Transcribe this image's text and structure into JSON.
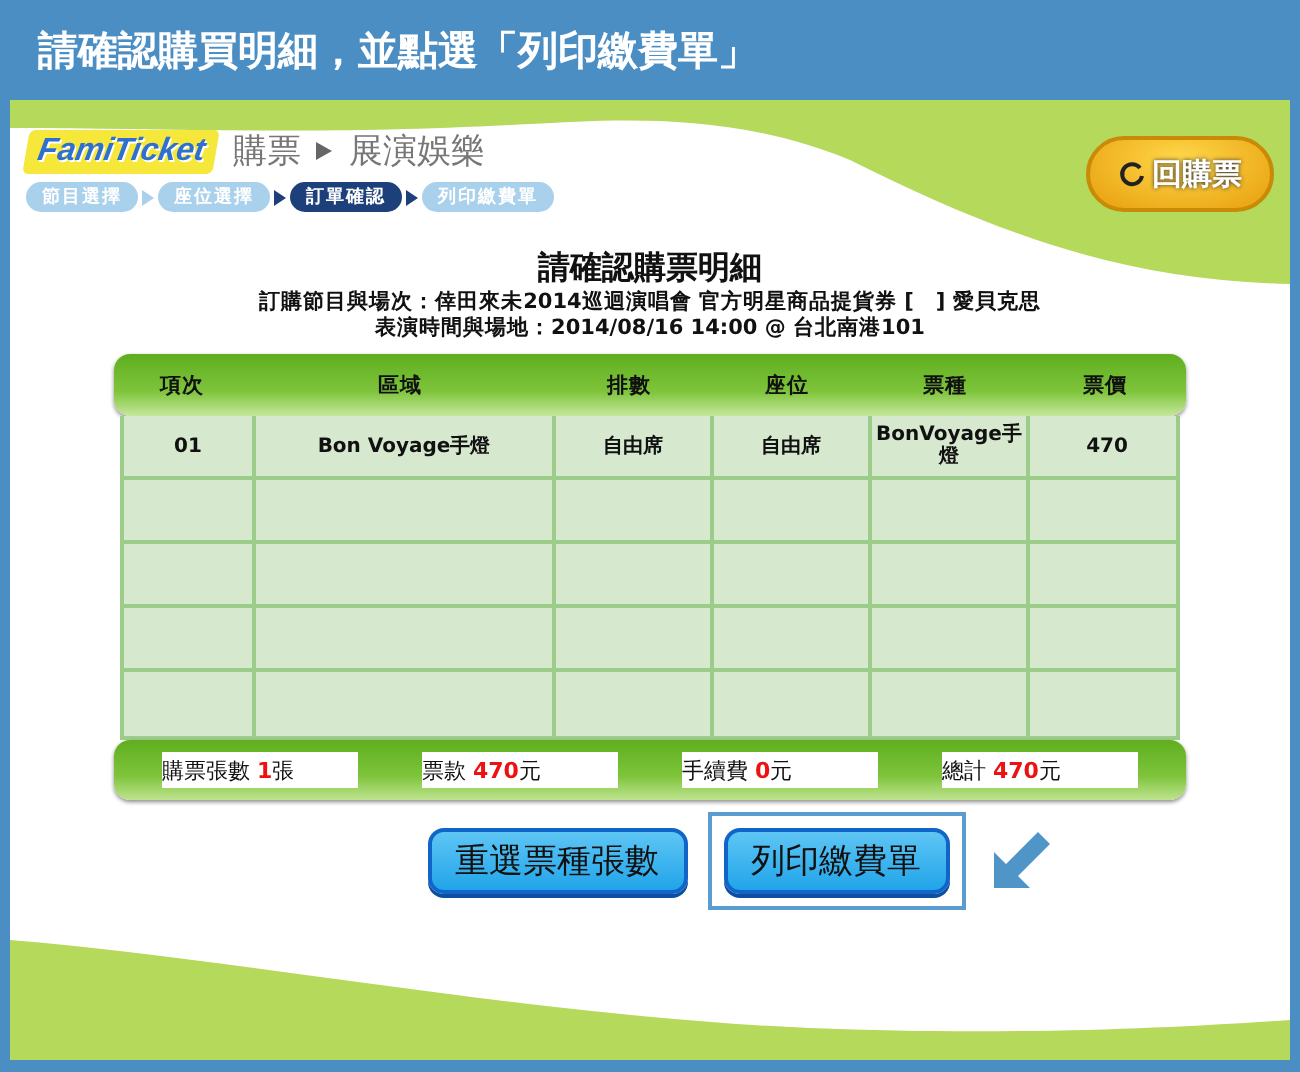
{
  "header": {
    "title": "請確認購買明細，並點選「列印繳費單」"
  },
  "logo": {
    "text": "FamiTicket"
  },
  "breadcrumb": [
    "購票",
    "展演娛樂"
  ],
  "return_button": {
    "label": "回購票"
  },
  "steps": [
    {
      "label": "節目選擇",
      "selected": false
    },
    {
      "label": "座位選擇",
      "selected": false
    },
    {
      "label": "訂單確認",
      "selected": true
    },
    {
      "label": "列印繳費單",
      "selected": false
    }
  ],
  "page_title": "請確認購票明細",
  "info_lines": [
    "訂購節目與場次：倖田來未2014巡迴演唱會 官方明星商品提貨券 [　] 愛貝克思",
    "表演時間與場地：2014/08/16 14:00 @ 台北南港101"
  ],
  "table": {
    "columns": [
      "項次",
      "區域",
      "排數",
      "座位",
      "票種",
      "票價"
    ],
    "rows": [
      [
        "01",
        "Bon Voyage手燈",
        "自由席",
        "自由席",
        "BonVoyage手燈",
        "470"
      ]
    ]
  },
  "summary": [
    {
      "label": "購票張數",
      "value": "1",
      "unit": "張"
    },
    {
      "label": "票款",
      "value": "470",
      "unit": "元"
    },
    {
      "label": "手續費",
      "value": "0",
      "unit": "元"
    },
    {
      "label": "總計",
      "value": "470",
      "unit": "元"
    }
  ],
  "buttons": [
    {
      "label": "重選票種張數",
      "highlighted": false
    },
    {
      "label": "列印繳費單",
      "highlighted": true
    }
  ]
}
